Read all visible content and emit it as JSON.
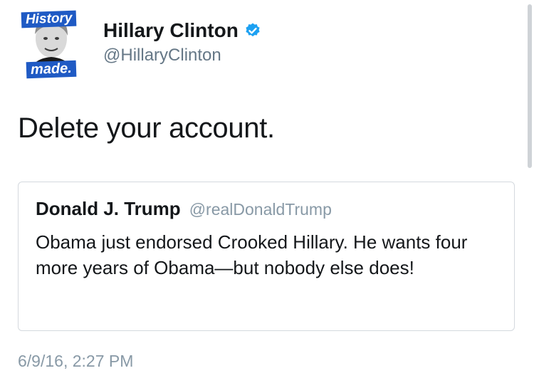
{
  "tweet": {
    "avatar": {
      "badge_top": "History",
      "badge_bottom": "made."
    },
    "author": {
      "display_name": "Hillary Clinton",
      "handle": "@HillaryClinton",
      "verified_icon": "verified-badge-icon"
    },
    "text": "Delete your account.",
    "quoted_tweet": {
      "display_name": "Donald J. Trump",
      "handle": "@realDonaldTrump",
      "text": "Obama just endorsed Crooked Hillary. He wants four more years of Obama—but nobody else does!"
    },
    "timestamp": "6/9/16, 2:27 PM"
  },
  "colors": {
    "text_primary": "#14171a",
    "text_secondary": "#8899a6",
    "verified_blue": "#1da1f2",
    "badge_blue": "#1f5ac4",
    "border": "#d4d9de"
  }
}
